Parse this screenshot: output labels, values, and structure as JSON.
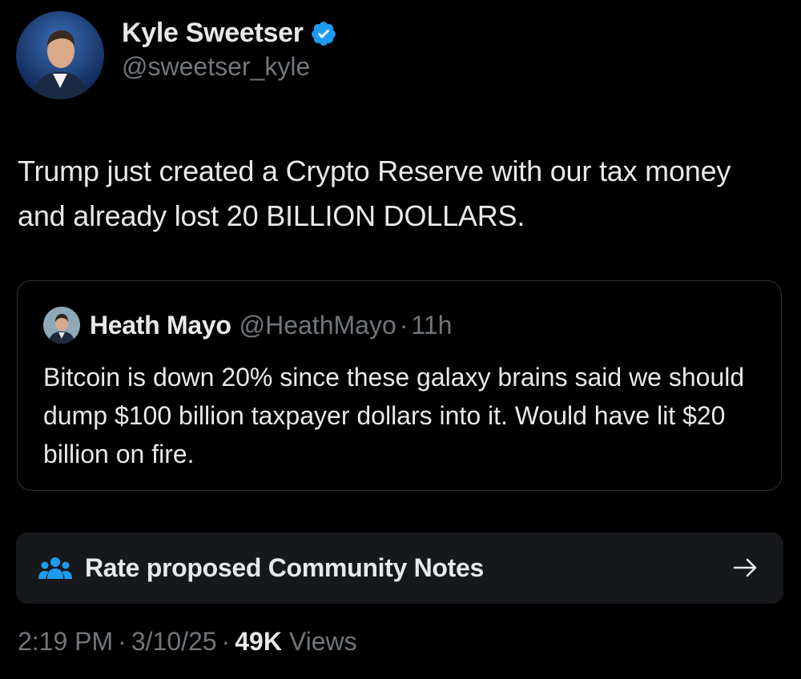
{
  "author": {
    "display_name": "Kyle Sweetser",
    "handle": "@sweetser_kyle",
    "verified_icon": "verified-badge-icon",
    "badge_color": "#1d9bf0"
  },
  "tweet": {
    "text": "Trump just created a Crypto Reserve with our tax money and already lost 20 BILLION DOLLARS."
  },
  "quote": {
    "display_name": "Heath Mayo",
    "handle": "@HeathMayo",
    "separator": "·",
    "time": "11h",
    "text": "Bitcoin is down 20% since these galaxy brains said we should dump $100 billion taxpayer dollars into it. Would have lit $20 billion on fire."
  },
  "community_notes": {
    "icon": "people-icon",
    "icon_color": "#1d9bf0",
    "label": "Rate proposed Community Notes",
    "arrow_icon": "arrow-right-icon"
  },
  "meta": {
    "time": "2:19 PM",
    "date": "3/10/25",
    "separator": "·",
    "views_count": "49K",
    "views_label": "Views"
  }
}
